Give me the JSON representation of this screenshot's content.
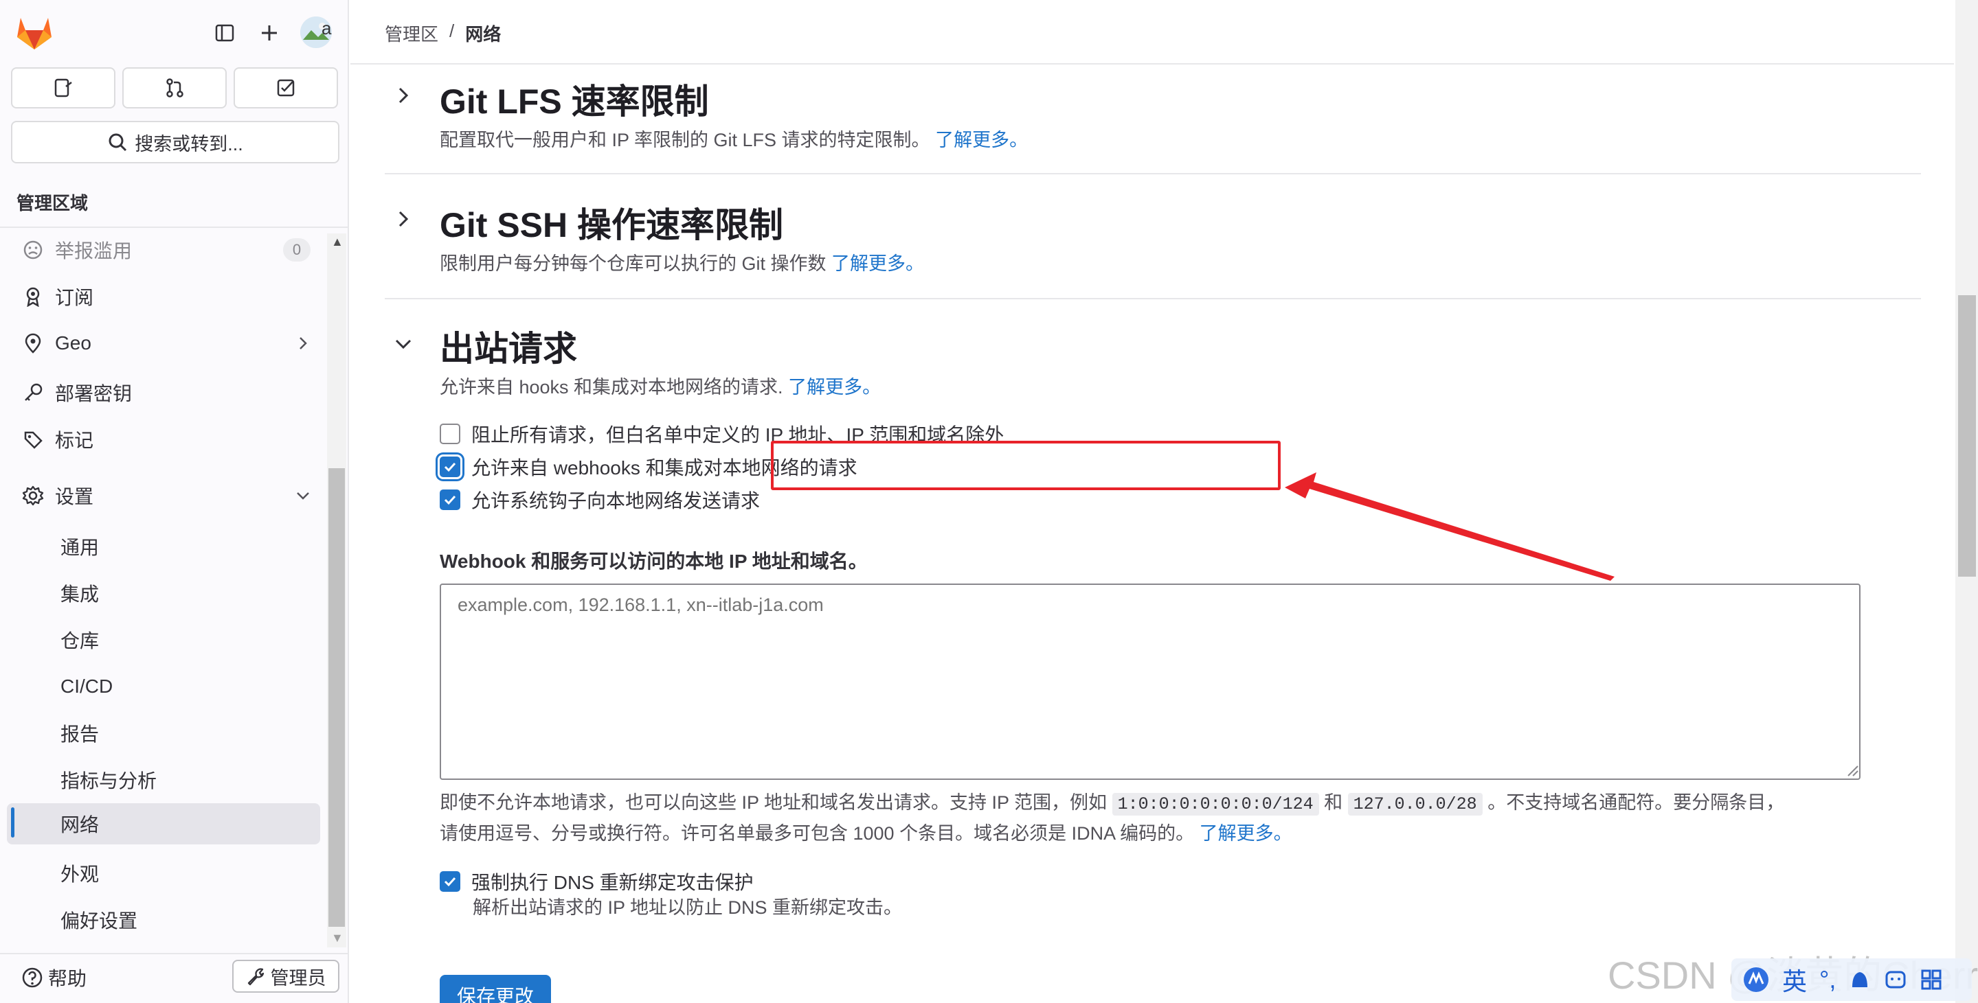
{
  "sidebar": {
    "avatar_text": "a",
    "search_label": "搜索或转到...",
    "section_title": "管理区域",
    "items": [
      {
        "label": "举报滥用",
        "badge": "0"
      },
      {
        "label": "订阅"
      },
      {
        "label": "Geo"
      },
      {
        "label": "部署密钥"
      },
      {
        "label": "标记"
      },
      {
        "label": "设置"
      }
    ],
    "settings_sub": [
      "通用",
      "集成",
      "仓库",
      "CI/CD",
      "报告",
      "指标与分析",
      "网络",
      "外观",
      "偏好设置"
    ],
    "help_label": "帮助",
    "admin_label": "管理员"
  },
  "breadcrumb": {
    "parent": "管理区",
    "sep": "/",
    "current": "网络"
  },
  "sections": {
    "lfs": {
      "title": "Git LFS 速率限制",
      "desc": "配置取代一般用户和 IP 率限制的 Git LFS 请求的特定限制。",
      "link": "了解更多。"
    },
    "ssh": {
      "title": "Git SSH 操作速率限制",
      "desc": "限制用户每分钟每个仓库可以执行的 Git 操作数",
      "link": "了解更多。"
    },
    "outbound": {
      "title": "出站请求",
      "desc": "允许来自 hooks 和集成对本地网络的请求.",
      "link": "了解更多。",
      "checkboxes": [
        {
          "label": "阻止所有请求，但白名单中定义的 IP 地址、IP 范围和域名除外",
          "checked": false
        },
        {
          "label": "允许来自 webhooks 和集成对本地网络的请求",
          "checked": true
        },
        {
          "label": "允许系统钩子向本地网络发送请求",
          "checked": true
        }
      ],
      "field_label": "Webhook 和服务可以访问的本地 IP 地址和域名。",
      "field_placeholder": "example.com, 192.168.1.1, xn--itlab-j1a.com",
      "help_part1": "即使不允许本地请求，也可以向这些 IP 地址和域名发出请求。支持 IP 范围，例如",
      "code1": "1:0:0:0:0:0:0:0/124",
      "help_and": "和",
      "code2": "127.0.0.0/28",
      "help_part2": "。不支持域名通配符。要分隔条目，请使用逗号、分号或换行符。许可名单最多可包含 1000 个条目。域名必须是 IDNA 编码的。",
      "help_link": "了解更多。",
      "dns_label": "强制执行 DNS 重新绑定攻击保护",
      "dns_checked": true,
      "dns_sub": "解析出站请求的 IP 地址以防止 DNS 重新绑定攻击。",
      "save_label": "保存更改"
    }
  },
  "overlay": {
    "watermark": "CSDN @淡黄的Cherry",
    "ime_label": "英"
  },
  "colors": {
    "accent": "#1f75cb",
    "annotation": "#e8232a",
    "brand": "#fc6d26"
  }
}
